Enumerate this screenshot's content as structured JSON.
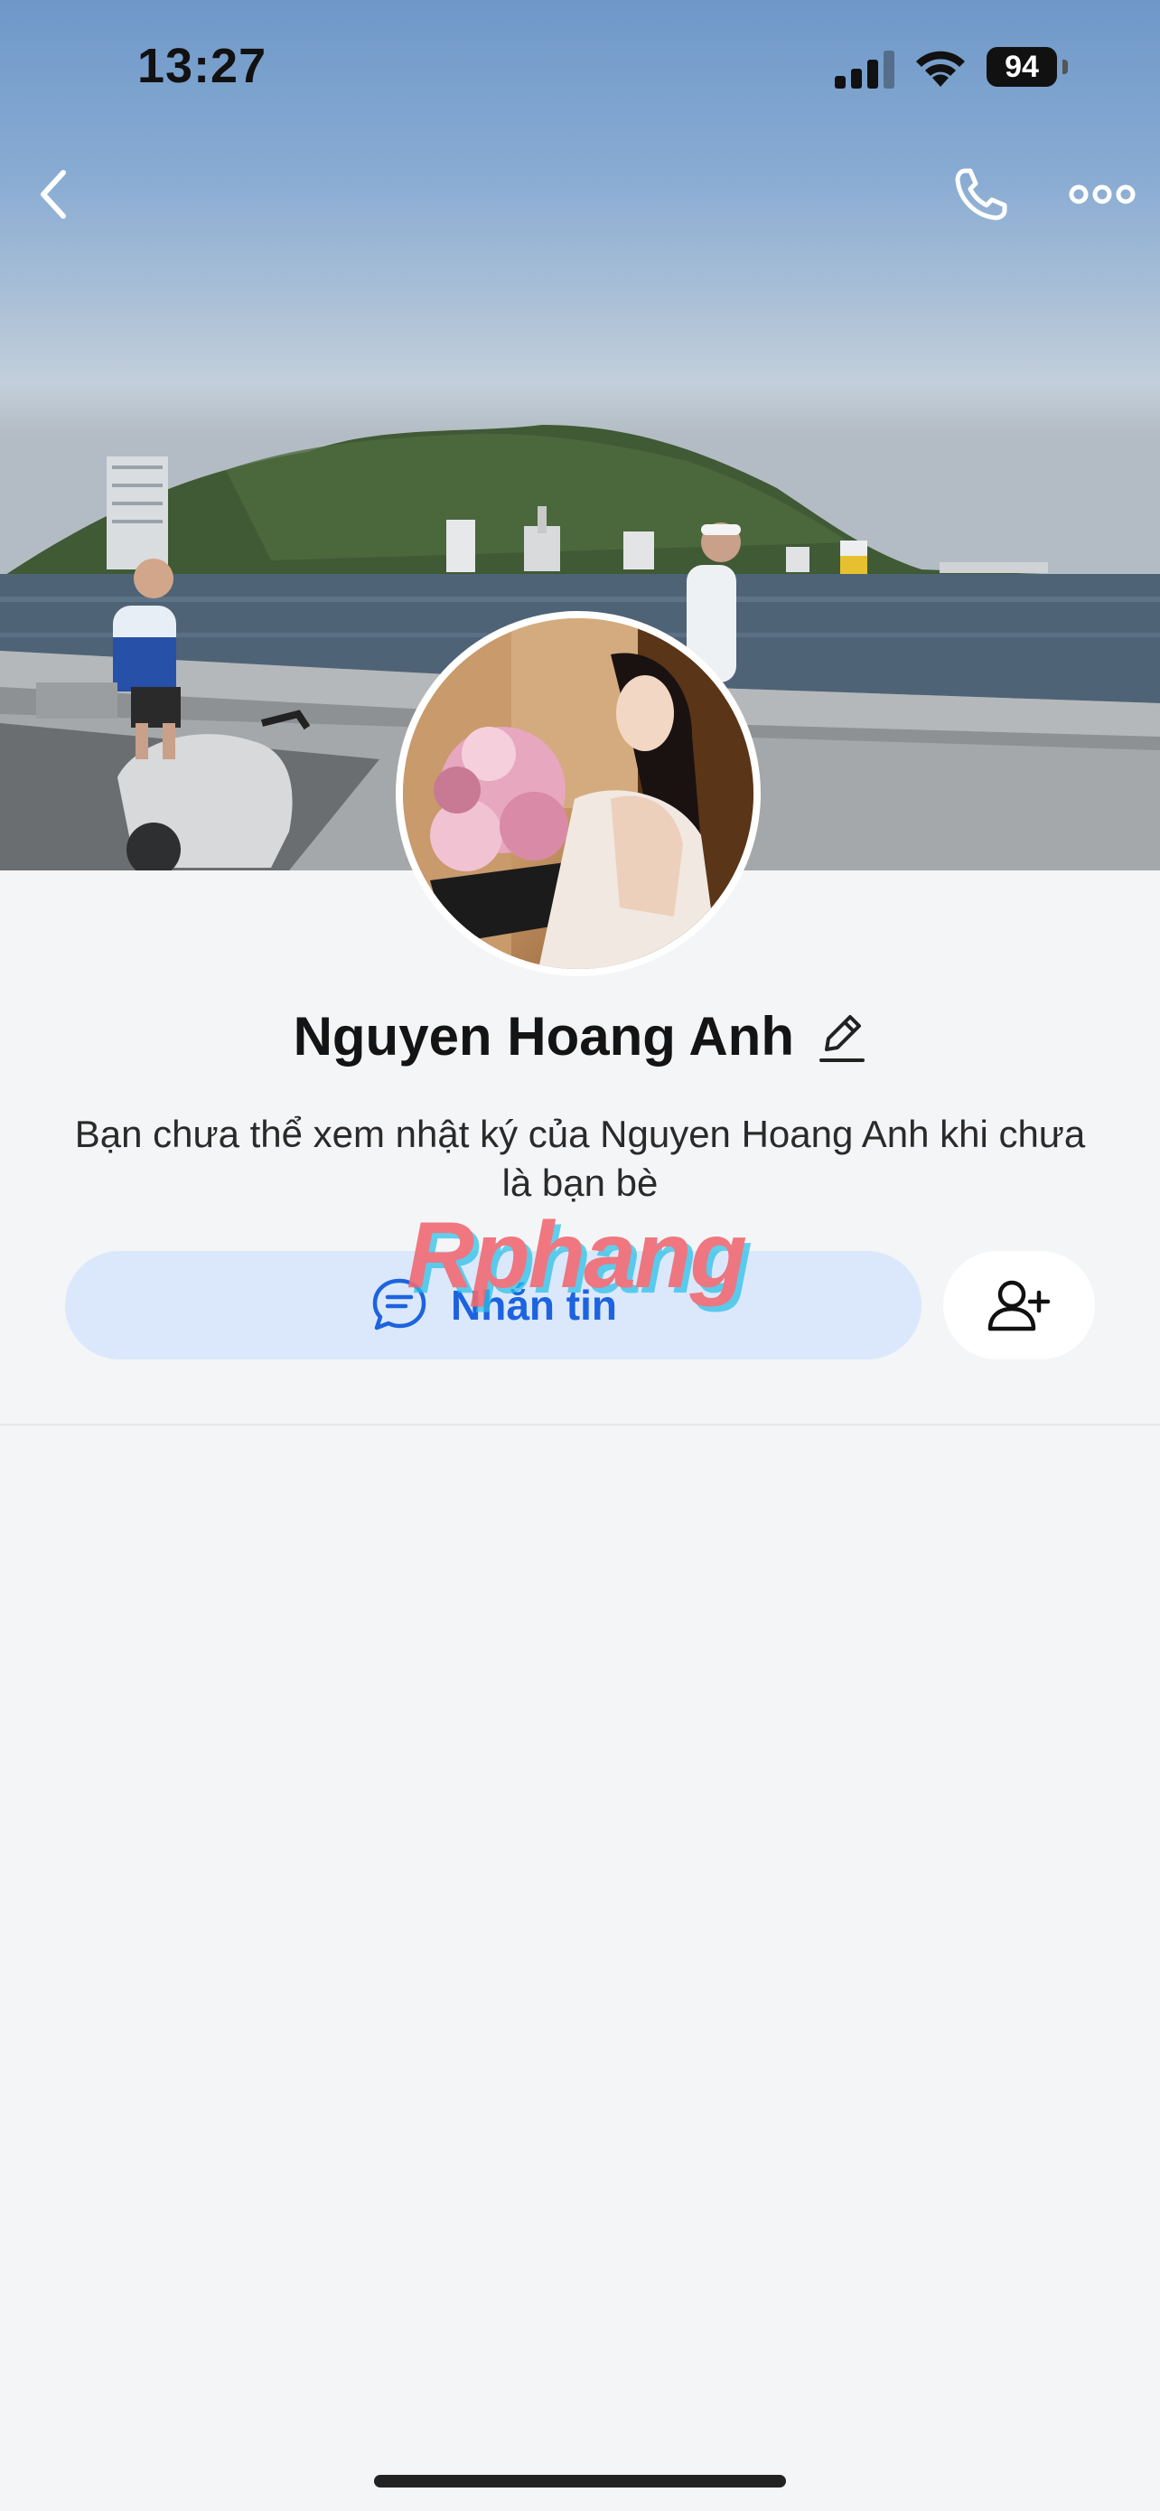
{
  "status_bar": {
    "time": "13:27",
    "battery": "94",
    "icons": [
      "cellular-signal-icon",
      "wifi-icon",
      "battery-icon"
    ]
  },
  "top_nav": {
    "back_icon": "chevron-left-icon",
    "call_icon": "phone-icon",
    "more_icon": "ellipsis-icon"
  },
  "profile": {
    "name": "Nguyen Hoang Anh",
    "edit_icon": "pencil-icon",
    "notice": "Bạn chưa thể xem nhật ký của Nguyen Hoang Anh khi chưa là bạn bè"
  },
  "actions": {
    "message_label": "Nhắn tin",
    "message_icon": "chat-bubble-icon",
    "add_friend_icon": "user-plus-icon"
  },
  "watermark": "Rphang",
  "colors": {
    "accent": "#1d63e0",
    "message_button_bg": "#dbe8fc",
    "page_bg": "#f4f5f6"
  }
}
